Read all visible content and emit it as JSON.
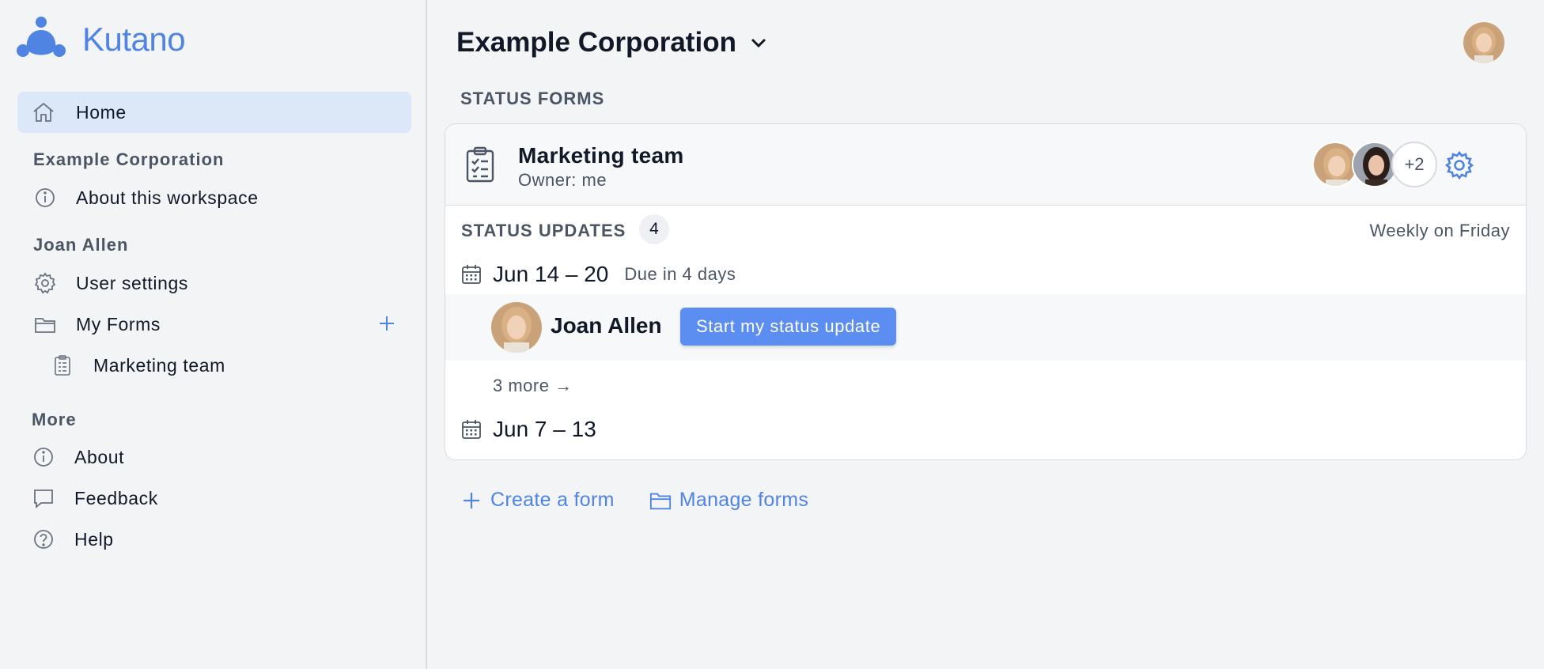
{
  "brand": {
    "name": "Kutano",
    "accent": "#4f84e3"
  },
  "sidebar": {
    "home": {
      "label": "Home",
      "icon": "home-icon"
    },
    "workspace_title": "Example Corporation",
    "about_workspace": {
      "label": "About this workspace",
      "icon": "info-icon"
    },
    "user_title": "Joan Allen",
    "user_settings": {
      "label": "User settings",
      "icon": "gear-icon"
    },
    "my_forms": {
      "label": "My Forms",
      "icon": "folder-icon"
    },
    "my_forms_items": [
      {
        "label": "Marketing team",
        "icon": "clipboard-icon"
      }
    ],
    "more_title": "More",
    "about": {
      "label": "About",
      "icon": "info-icon"
    },
    "feedback": {
      "label": "Feedback",
      "icon": "chat-bubble-icon"
    },
    "help": {
      "label": "Help",
      "icon": "question-icon"
    }
  },
  "header": {
    "workspace": "Example Corporation"
  },
  "main": {
    "status_forms_label": "STATUS FORMS",
    "form": {
      "title": "Marketing team",
      "owner": "Owner: me",
      "extra_members": "+2",
      "status_updates_label": "STATUS UPDATES",
      "status_updates_count": "4",
      "schedule": "Weekly on Friday",
      "current_week": {
        "range": "Jun 14 – 20",
        "due": "Due in 4 days"
      },
      "user_row": {
        "name": "Joan Allen",
        "button": "Start my status update"
      },
      "more_link": "3 more →",
      "previous_week": {
        "range": "Jun 7 – 13"
      }
    },
    "actions": {
      "create": "Create a form",
      "manage": "Manage forms"
    }
  }
}
